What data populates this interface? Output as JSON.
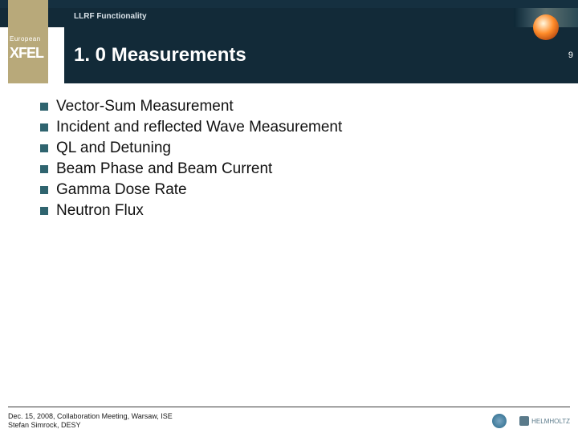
{
  "header": {
    "breadcrumb": "LLRF Functionality",
    "slide_number": "9"
  },
  "logo": {
    "line1": "European",
    "line2": "XFEL"
  },
  "title": "1. 0 Measurements",
  "bullets": [
    "Vector-Sum Measurement",
    "Incident and reflected Wave Measurement",
    "QL and Detuning",
    "Beam Phase and Beam Current",
    "Gamma Dose Rate",
    "Neutron Flux"
  ],
  "footer": {
    "line1": "Dec. 15, 2008, Collaboration Meeting, Warsaw, ISE",
    "line2": "Stefan Simrock, DESY",
    "assoc": "HELMHOLTZ"
  }
}
